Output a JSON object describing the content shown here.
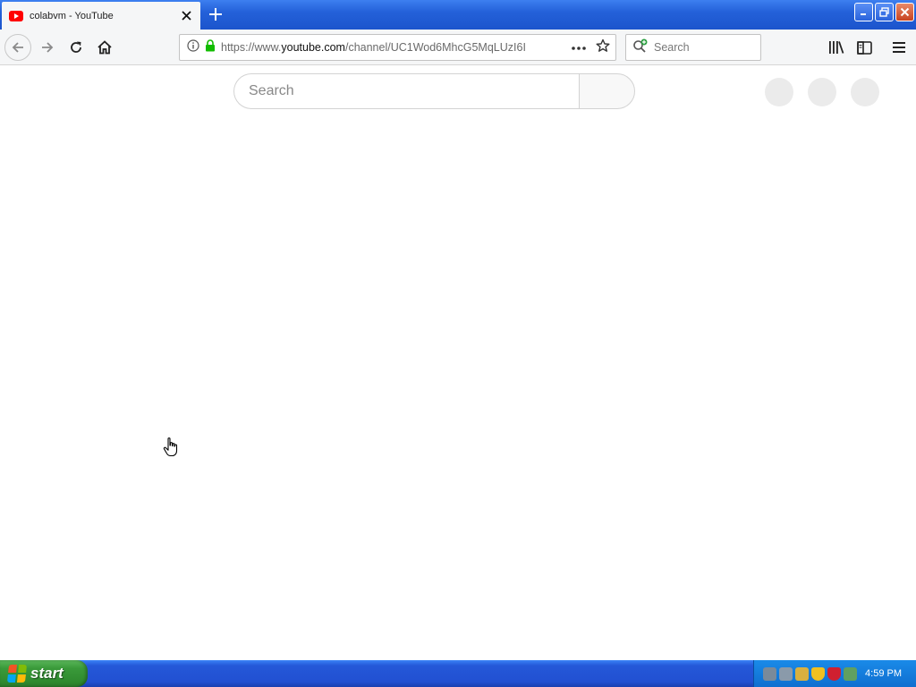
{
  "browser": {
    "tab": {
      "title": "colabvm - YouTube"
    },
    "url": {
      "prefix": "https://www.",
      "host": "youtube.com",
      "path": "/channel/UC1Wod6MhcG5MqLUzI6I"
    },
    "search_placeholder": "Search"
  },
  "page": {
    "search_placeholder": "Search"
  },
  "taskbar": {
    "start_label": "start",
    "clock": "4:59 PM"
  },
  "colors": {
    "titlebar": "#2461d9",
    "youtube_red": "#ff0000",
    "placeholder_circle": "#ebebeb",
    "start_green": "#3a9a3a"
  }
}
